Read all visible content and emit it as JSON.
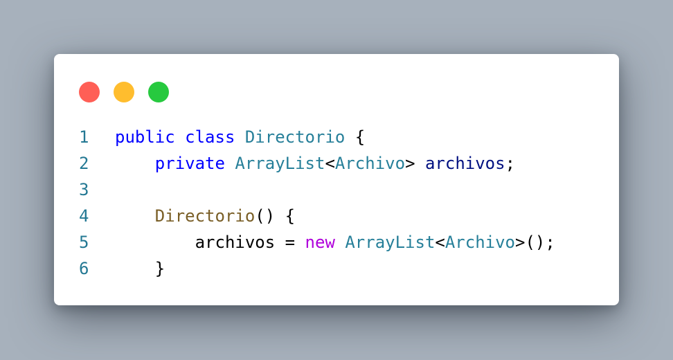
{
  "colors": {
    "background": "#a7b1bc",
    "window": "#ffffff",
    "dot_close": "#ff5f56",
    "dot_minimize": "#ffbd2e",
    "dot_maximize": "#27c93f",
    "line_number": "#237893",
    "keyword": "#0000ff",
    "type": "#267f99",
    "function": "#795e26",
    "control_keyword": "#af00db",
    "variable": "#001080",
    "punctuation": "#000000",
    "default": "#000000"
  },
  "window_dots": [
    "close-dot",
    "minimize-dot",
    "maximize-dot"
  ],
  "lines": [
    {
      "number": "1",
      "tokens": [
        {
          "text": "public",
          "kind": "keyword"
        },
        {
          "text": " ",
          "kind": "default"
        },
        {
          "text": "class",
          "kind": "keyword"
        },
        {
          "text": " ",
          "kind": "default"
        },
        {
          "text": "Directorio",
          "kind": "type"
        },
        {
          "text": " {",
          "kind": "punctuation"
        }
      ]
    },
    {
      "number": "2",
      "tokens": [
        {
          "text": "    ",
          "kind": "default"
        },
        {
          "text": "private",
          "kind": "keyword"
        },
        {
          "text": " ",
          "kind": "default"
        },
        {
          "text": "ArrayList",
          "kind": "type"
        },
        {
          "text": "<",
          "kind": "punctuation"
        },
        {
          "text": "Archivo",
          "kind": "type"
        },
        {
          "text": "> ",
          "kind": "punctuation"
        },
        {
          "text": "archivos",
          "kind": "variable"
        },
        {
          "text": ";",
          "kind": "punctuation"
        }
      ]
    },
    {
      "number": "3",
      "tokens": []
    },
    {
      "number": "4",
      "tokens": [
        {
          "text": "    ",
          "kind": "default"
        },
        {
          "text": "Directorio",
          "kind": "function"
        },
        {
          "text": "() {",
          "kind": "punctuation"
        }
      ]
    },
    {
      "number": "5",
      "tokens": [
        {
          "text": "        ",
          "kind": "default"
        },
        {
          "text": "archivos",
          "kind": "default"
        },
        {
          "text": " = ",
          "kind": "punctuation"
        },
        {
          "text": "new",
          "kind": "control_keyword"
        },
        {
          "text": " ",
          "kind": "default"
        },
        {
          "text": "ArrayList",
          "kind": "type"
        },
        {
          "text": "<",
          "kind": "punctuation"
        },
        {
          "text": "Archivo",
          "kind": "type"
        },
        {
          "text": ">();",
          "kind": "punctuation"
        }
      ]
    },
    {
      "number": "6",
      "tokens": [
        {
          "text": "    ",
          "kind": "default"
        },
        {
          "text": "}",
          "kind": "punctuation"
        }
      ]
    }
  ]
}
